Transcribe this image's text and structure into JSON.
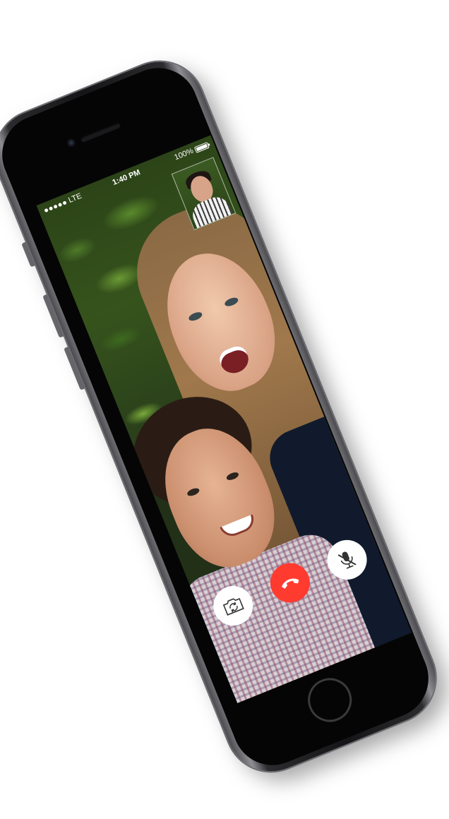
{
  "status_bar": {
    "carrier": "LTE",
    "time": "1:40 PM",
    "battery_percent": "100%",
    "signal_bars": 5
  },
  "controls": {
    "flip_camera_icon": "camera-rotate-icon",
    "end_call_icon": "phone-hangup-icon",
    "mute_icon": "microphone-slash-icon",
    "end_call_color": "#ff3b30"
  },
  "device": {
    "color": "space-gray"
  }
}
